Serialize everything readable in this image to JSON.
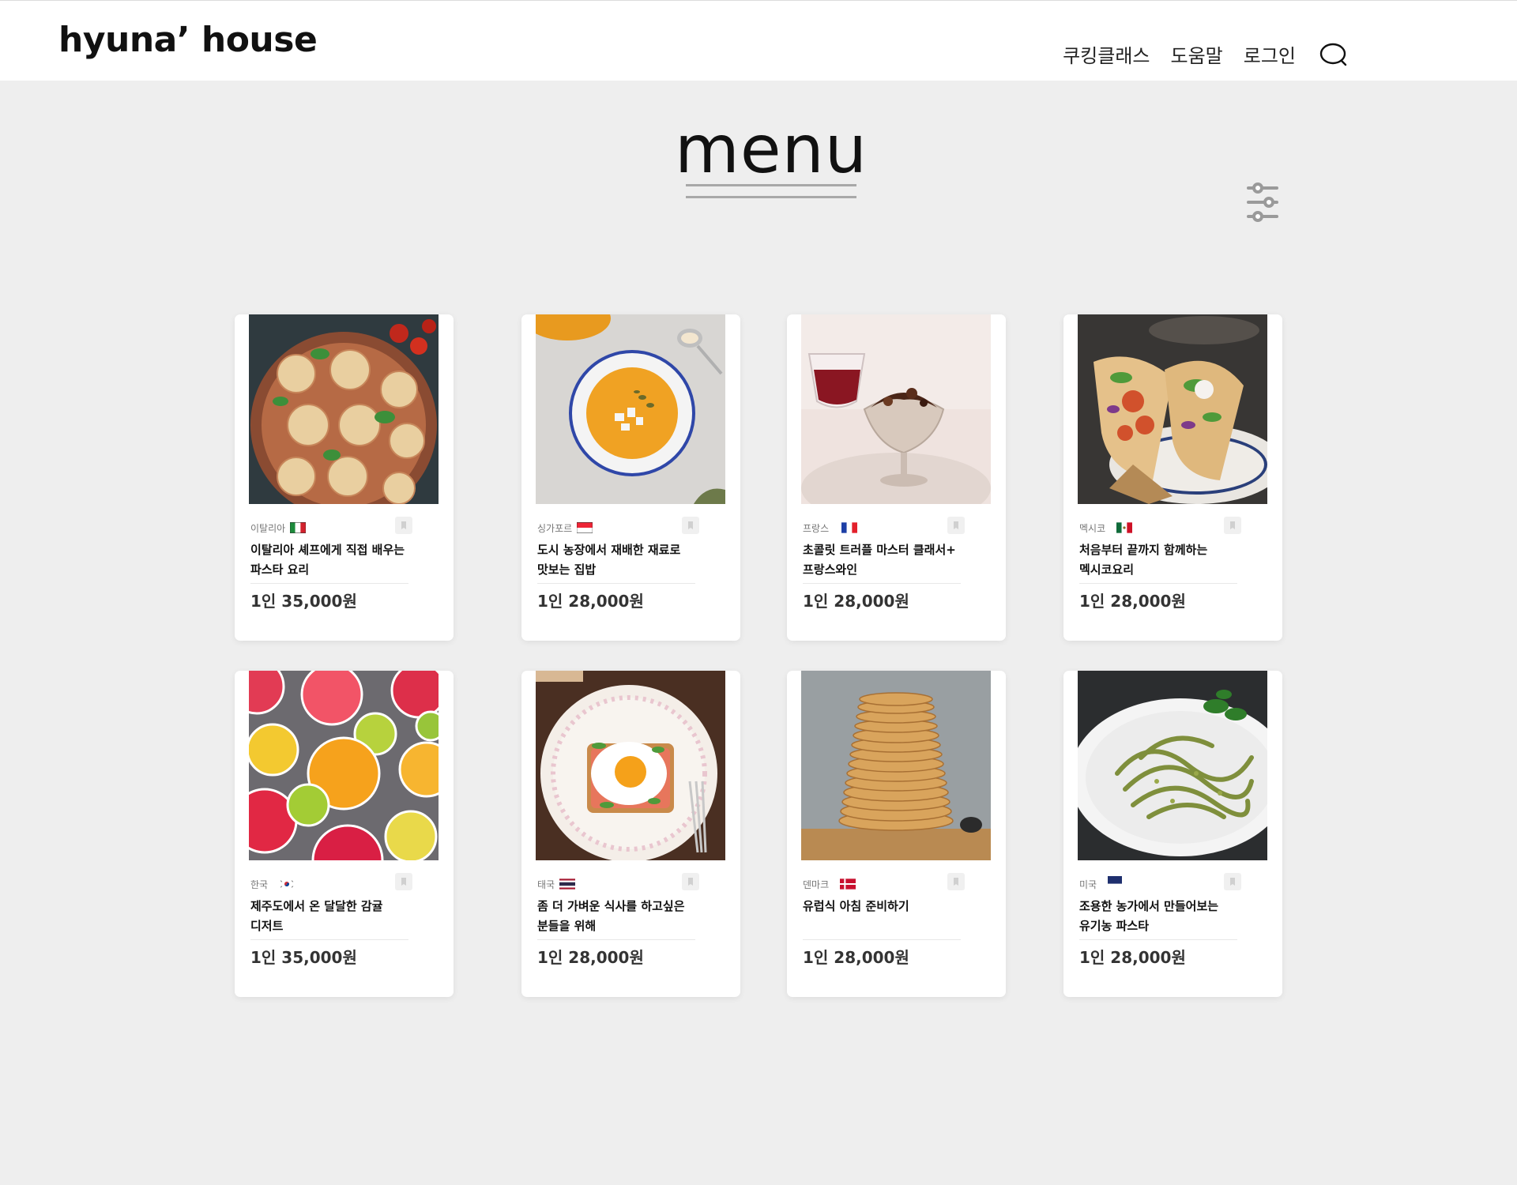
{
  "header": {
    "logo": "hyuna’ house",
    "nav": [
      "쿠킹클래스",
      "도움말",
      "로그인"
    ],
    "search_icon": "search-icon"
  },
  "page": {
    "title": "menu",
    "filter_icon": "sliders-icon"
  },
  "cards": [
    {
      "country": "이탈리아",
      "flag": "italy-flag",
      "title": "이탈리아 셰프에게 직접 배우는 파스타 요리",
      "price": "1인 35,000원",
      "image": "pasta-nests-photo"
    },
    {
      "country": "싱가포르",
      "flag": "singapore-flag",
      "title": "도시 농장에서 재배한 재료로 맛보는 집밥",
      "price": "1인 28,000원",
      "image": "pumpkin-soup-photo"
    },
    {
      "country": "프랑스",
      "flag": "france-flag",
      "title": "초콜릿 트러플 마스터 클래서+ 프랑스와인",
      "price": "1인 28,000원",
      "image": "chocolate-dessert-photo"
    },
    {
      "country": "멕시코",
      "flag": "mexico-flag",
      "title": "처음부터 끝까지 함께하는 멕시코요리",
      "price": "1인 28,000원",
      "image": "tacos-photo"
    },
    {
      "country": "한국",
      "flag": "korea-flag",
      "title": "제주도에서 온 달달한 감귤 디저트",
      "price": "1인 35,000원",
      "image": "citrus-slices-photo"
    },
    {
      "country": "태국",
      "flag": "thailand-flag",
      "title": "좀 더 가벼운 식사를 하고싶은 분들을 위해",
      "price": "1인 28,000원",
      "image": "egg-toast-photo"
    },
    {
      "country": "덴마크",
      "flag": "denmark-flag",
      "title": "유럽식 아침 준비하기",
      "price": "1인 28,000원",
      "image": "pancake-stack-photo"
    },
    {
      "country": "미국",
      "flag": "usa-flag",
      "title": "조용한 농가에서 만들어보는 유기농 파스타",
      "price": "1인 28,000원",
      "image": "pesto-pasta-photo"
    }
  ]
}
